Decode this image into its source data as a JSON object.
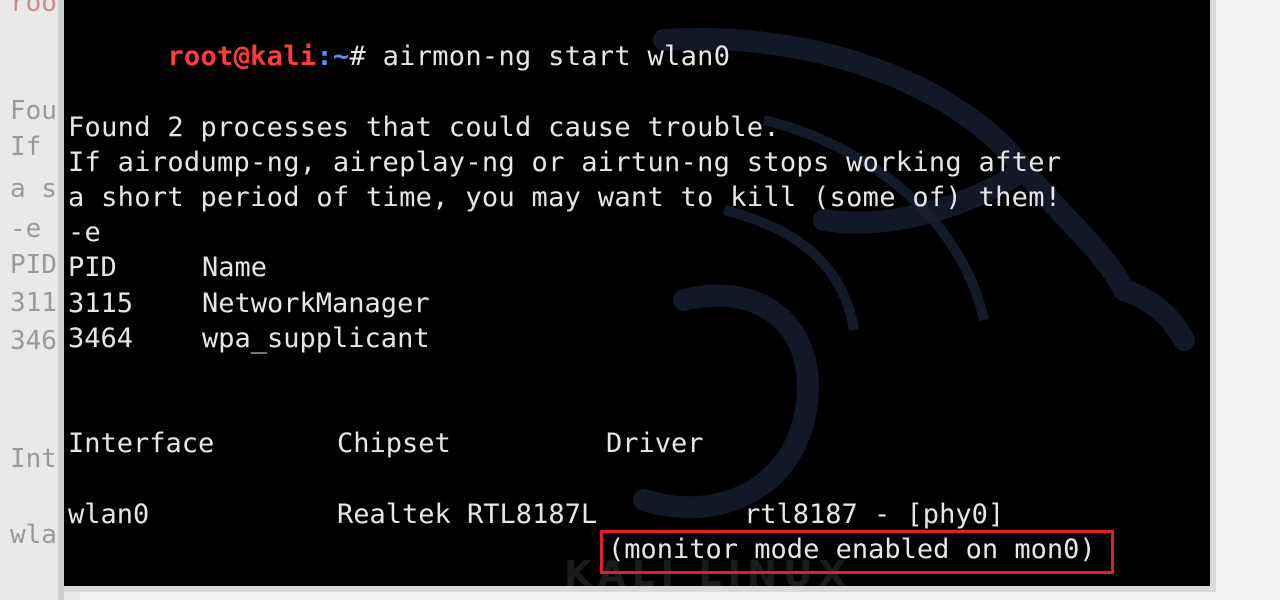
{
  "background_terminal": {
    "lines": [
      "roo",
      "Fou",
      "If",
      "a s",
      "-e",
      "PID",
      "311",
      "346",
      "Int",
      "wla"
    ]
  },
  "terminal": {
    "prompt": {
      "user": "root@kali",
      "path": ":~",
      "symbol": "#",
      "command": " airmon-ng start wlan0"
    },
    "warning": [
      "Found 2 processes that could cause trouble.",
      "If airodump-ng, aireplay-ng or airtun-ng stops working after",
      "a short period of time, you may want to kill (some of) them!",
      "-e"
    ],
    "process_table": {
      "headers": [
        "PID",
        "Name"
      ],
      "rows": [
        [
          "3115",
          "NetworkManager"
        ],
        [
          "3464",
          "wpa_supplicant"
        ]
      ]
    },
    "interface_table": {
      "headers": [
        "Interface",
        "Chipset",
        "Driver"
      ],
      "rows": [
        [
          "wlan0",
          "Realtek RTL8187L",
          "rtl8187 - [phy0]"
        ]
      ]
    },
    "monitor_status": "(monitor mode enabled on mon0)"
  },
  "colors": {
    "terminal_bg": "#000000",
    "text": "#e6e6e6",
    "prompt_user": "#ff3b3b",
    "prompt_path": "#5a8cff",
    "highlight_box": "#e01f2a"
  }
}
